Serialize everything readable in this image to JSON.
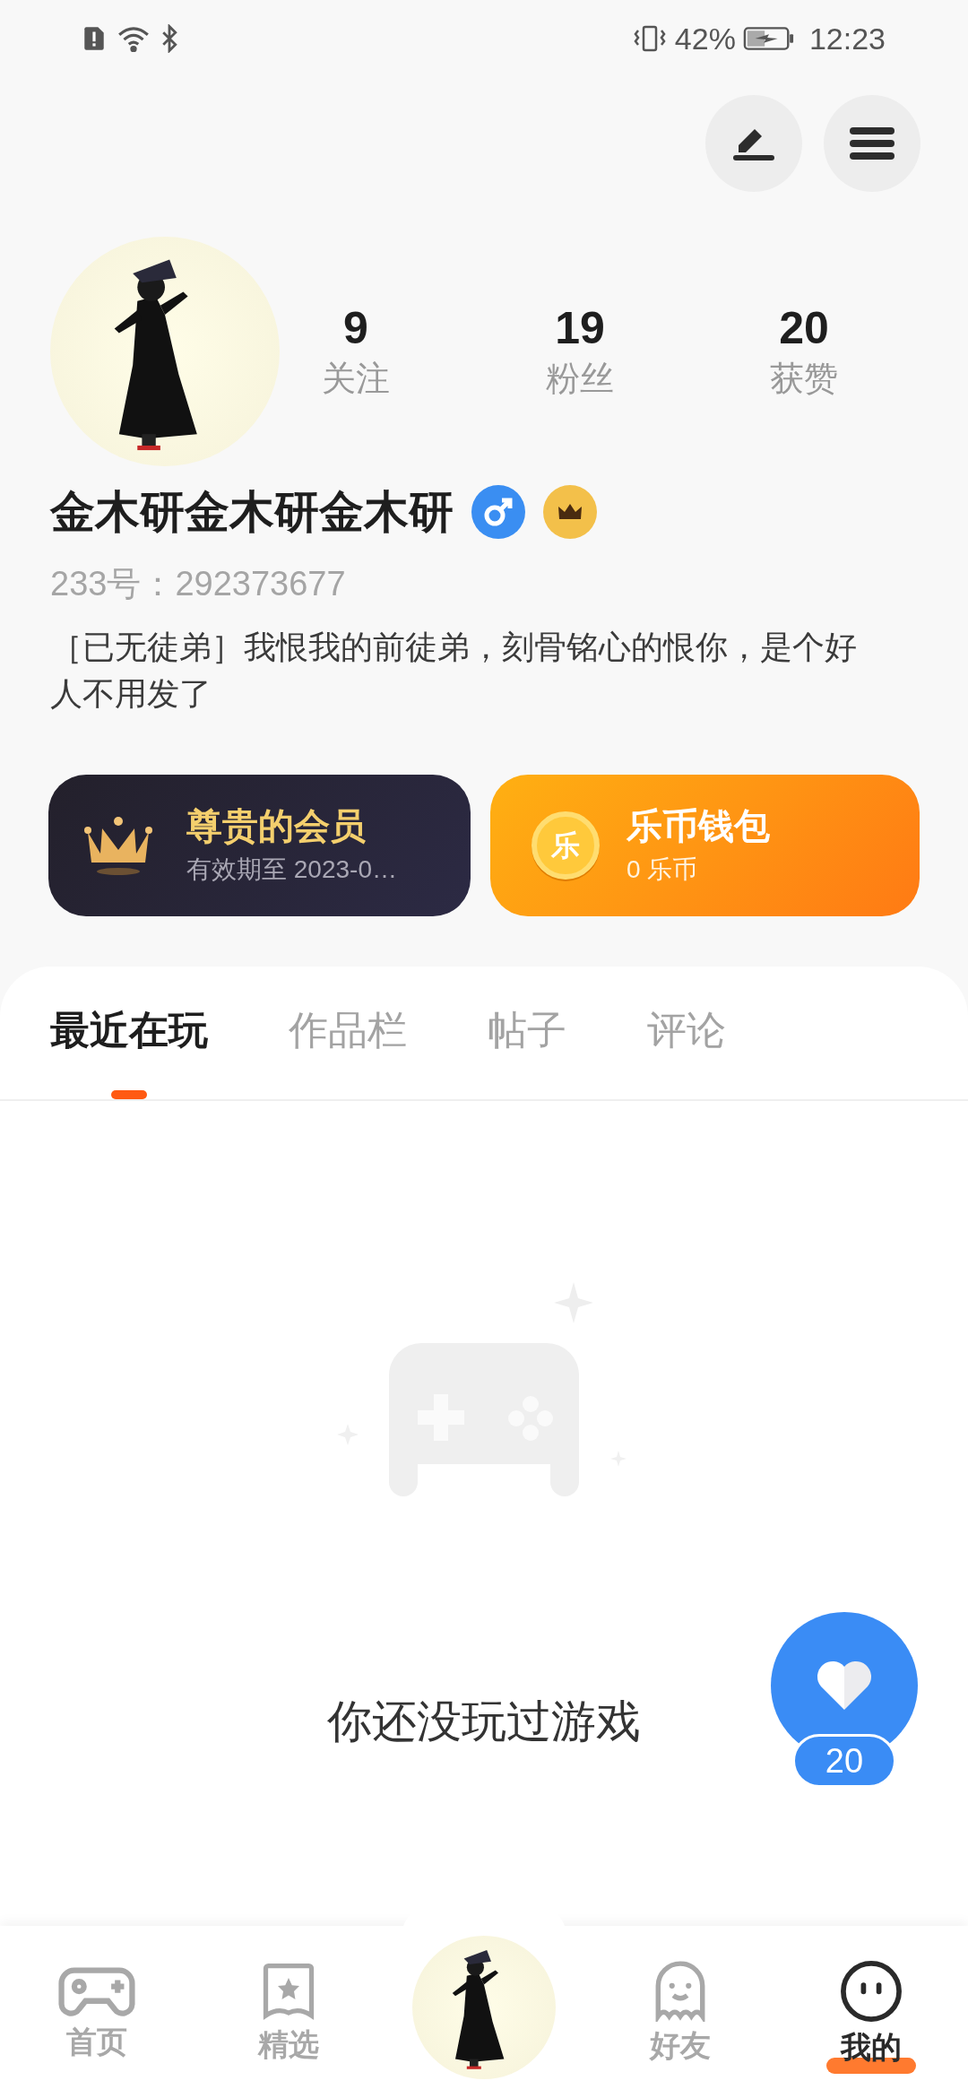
{
  "status_bar": {
    "battery": "42%",
    "time": "12:23"
  },
  "profile": {
    "stats": [
      {
        "value": "9",
        "label": "关注"
      },
      {
        "value": "19",
        "label": "粉丝"
      },
      {
        "value": "20",
        "label": "获赞"
      }
    ],
    "name": "金木研金木研金木研",
    "id_line": "233号：292373677",
    "bio": "［已无徒弟］我恨我的前徒弟，刻骨铭心的恨你，是个好人不用发了"
  },
  "cards": [
    {
      "kind": "vip",
      "title": "尊贵的会员",
      "subtitle": "有效期至 2023-0…"
    },
    {
      "kind": "wallet",
      "title": "乐币钱包",
      "subtitle": "0 乐币",
      "coin": "乐"
    }
  ],
  "tabs": [
    {
      "label": "最近在玩",
      "selected": true
    },
    {
      "label": "作品栏",
      "selected": false
    },
    {
      "label": "帖子",
      "selected": false
    },
    {
      "label": "评论",
      "selected": false
    }
  ],
  "empty_message": "你还没玩过游戏",
  "like_button": {
    "count": "20"
  },
  "nav": [
    {
      "label": "首页",
      "selected": false
    },
    {
      "label": "精选",
      "selected": false
    },
    {
      "label": "好友",
      "selected": false
    },
    {
      "label": "我的",
      "selected": true
    }
  ]
}
